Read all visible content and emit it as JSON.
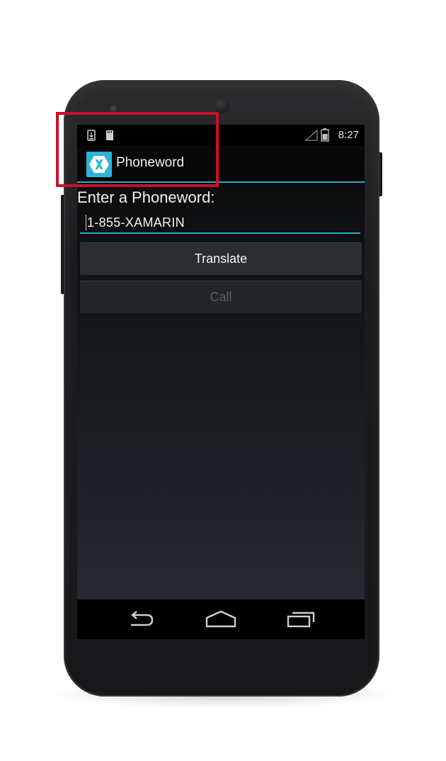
{
  "status_bar": {
    "time": "8:27",
    "icons": [
      "download-notification-icon",
      "sd-card-icon",
      "signal-icon",
      "battery-icon"
    ]
  },
  "action_bar": {
    "app_icon": "xamarin-logo-icon",
    "title": "Phoneword"
  },
  "main": {
    "prompt": "Enter a Phoneword:",
    "phoneword_input": {
      "value": "1-855-XAMARIN"
    },
    "translate_button": "Translate",
    "call_button": "Call"
  },
  "nav_bar": {
    "icons": [
      "back-icon",
      "home-icon",
      "recent-apps-icon"
    ]
  },
  "colors": {
    "accent": "#2aa9c9",
    "app_icon_bg": "#2ab5d8",
    "highlight_box": "#c8102e"
  }
}
